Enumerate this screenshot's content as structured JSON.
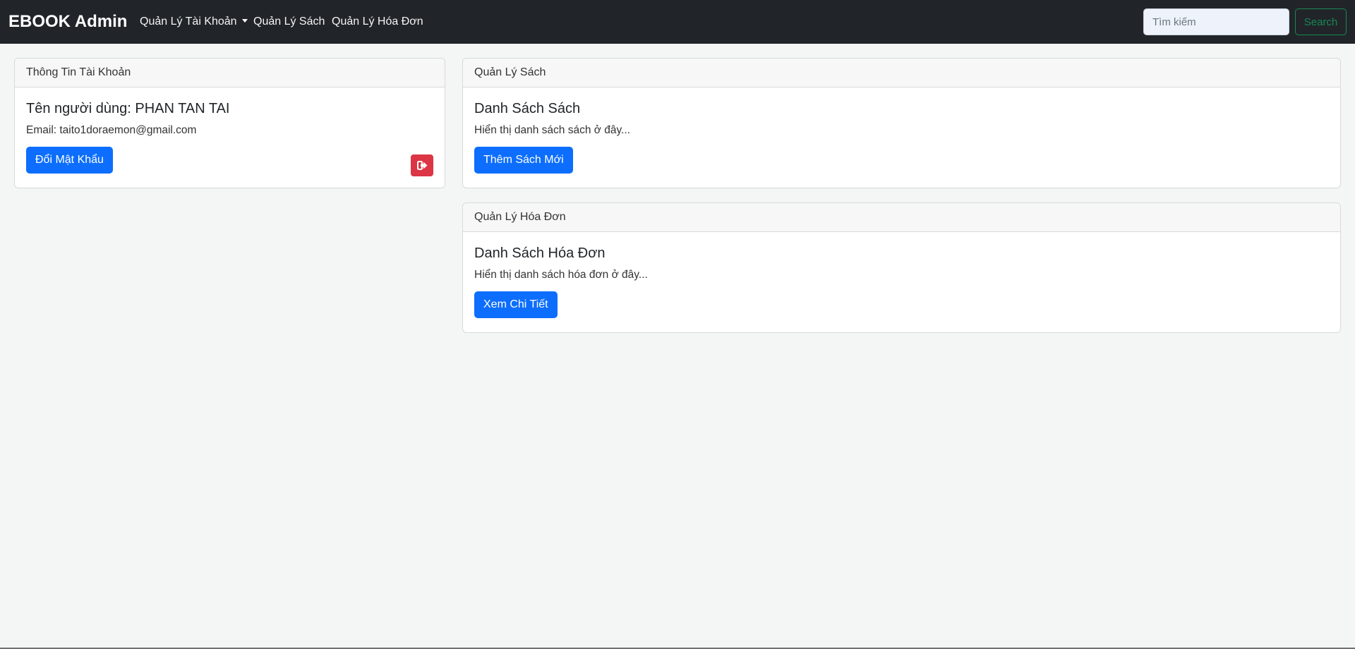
{
  "navbar": {
    "brand": "EBOOK Admin",
    "items": [
      {
        "label": "Quản Lý Tài Khoản",
        "has_dropdown": true
      },
      {
        "label": "Quản Lý Sách"
      },
      {
        "label": "Quản Lý Hóa Đơn"
      }
    ],
    "search": {
      "placeholder": "Tìm kiếm",
      "value": "",
      "button_label": "Search"
    }
  },
  "account_card": {
    "header": "Thông Tin Tài Khoản",
    "username": "Tên người dùng: PHAN TAN TAI",
    "email": "Email: taito1doraemon@gmail.com",
    "change_password_label": "Đổi Mật Khẩu",
    "logout_icon": "sign-out-icon"
  },
  "books_card": {
    "header": "Quản Lý Sách",
    "title": "Danh Sách Sách",
    "text": "Hiển thị danh sách sách ở đây...",
    "button_label": "Thêm Sách Mới"
  },
  "invoices_card": {
    "header": "Quản Lý Hóa Đơn",
    "title": "Danh Sách Hóa Đơn",
    "text": "Hiển thị danh sách hóa đơn ở đây...",
    "button_label": "Xem Chi Tiết"
  },
  "colors": {
    "navbar_bg": "#212529",
    "primary": "#0d6efd",
    "danger": "#dc3545",
    "success": "#198754",
    "page_bg": "#f4f5f5"
  }
}
